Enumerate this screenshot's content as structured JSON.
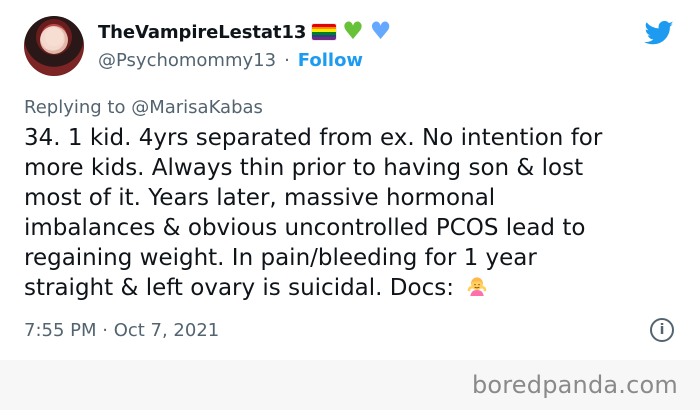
{
  "tweet": {
    "user": {
      "display_name": "TheVampireLestat13",
      "handle": "@Psychomommy13",
      "separator": "·",
      "follow_label": "Follow"
    },
    "replying_to": "Replying to @MarisaKabas",
    "body_lines": [
      "34. 1 kid. 4yrs separated from ex. No intention for",
      "more kids. Always thin prior to having son & lost",
      "most of it. Years later, massive hormonal",
      "imbalances & obvious uncontrolled PCOS lead to",
      "regaining weight. In pain/bleeding for 1 year",
      "straight & left ovary is suicidal. Docs:"
    ],
    "timestamp": "7:55 PM · Oct 7, 2021",
    "icons": {
      "avatar": "profile-avatar",
      "pride_flag": "rainbow-flag-icon",
      "green_heart": "green-heart-icon",
      "blue_heart": "blue-heart-icon",
      "twitter": "twitter-bird-icon",
      "emoji": "person-shrugging-emoji",
      "info": "info-icon"
    },
    "colors": {
      "text": "#0f1419",
      "secondary": "#536471",
      "accent": "#1d9bf0",
      "background": "#ffffff",
      "footer_background": "#f7f7f7",
      "watermark": "#8a8a8a"
    }
  },
  "watermark": "boredpanda.com"
}
